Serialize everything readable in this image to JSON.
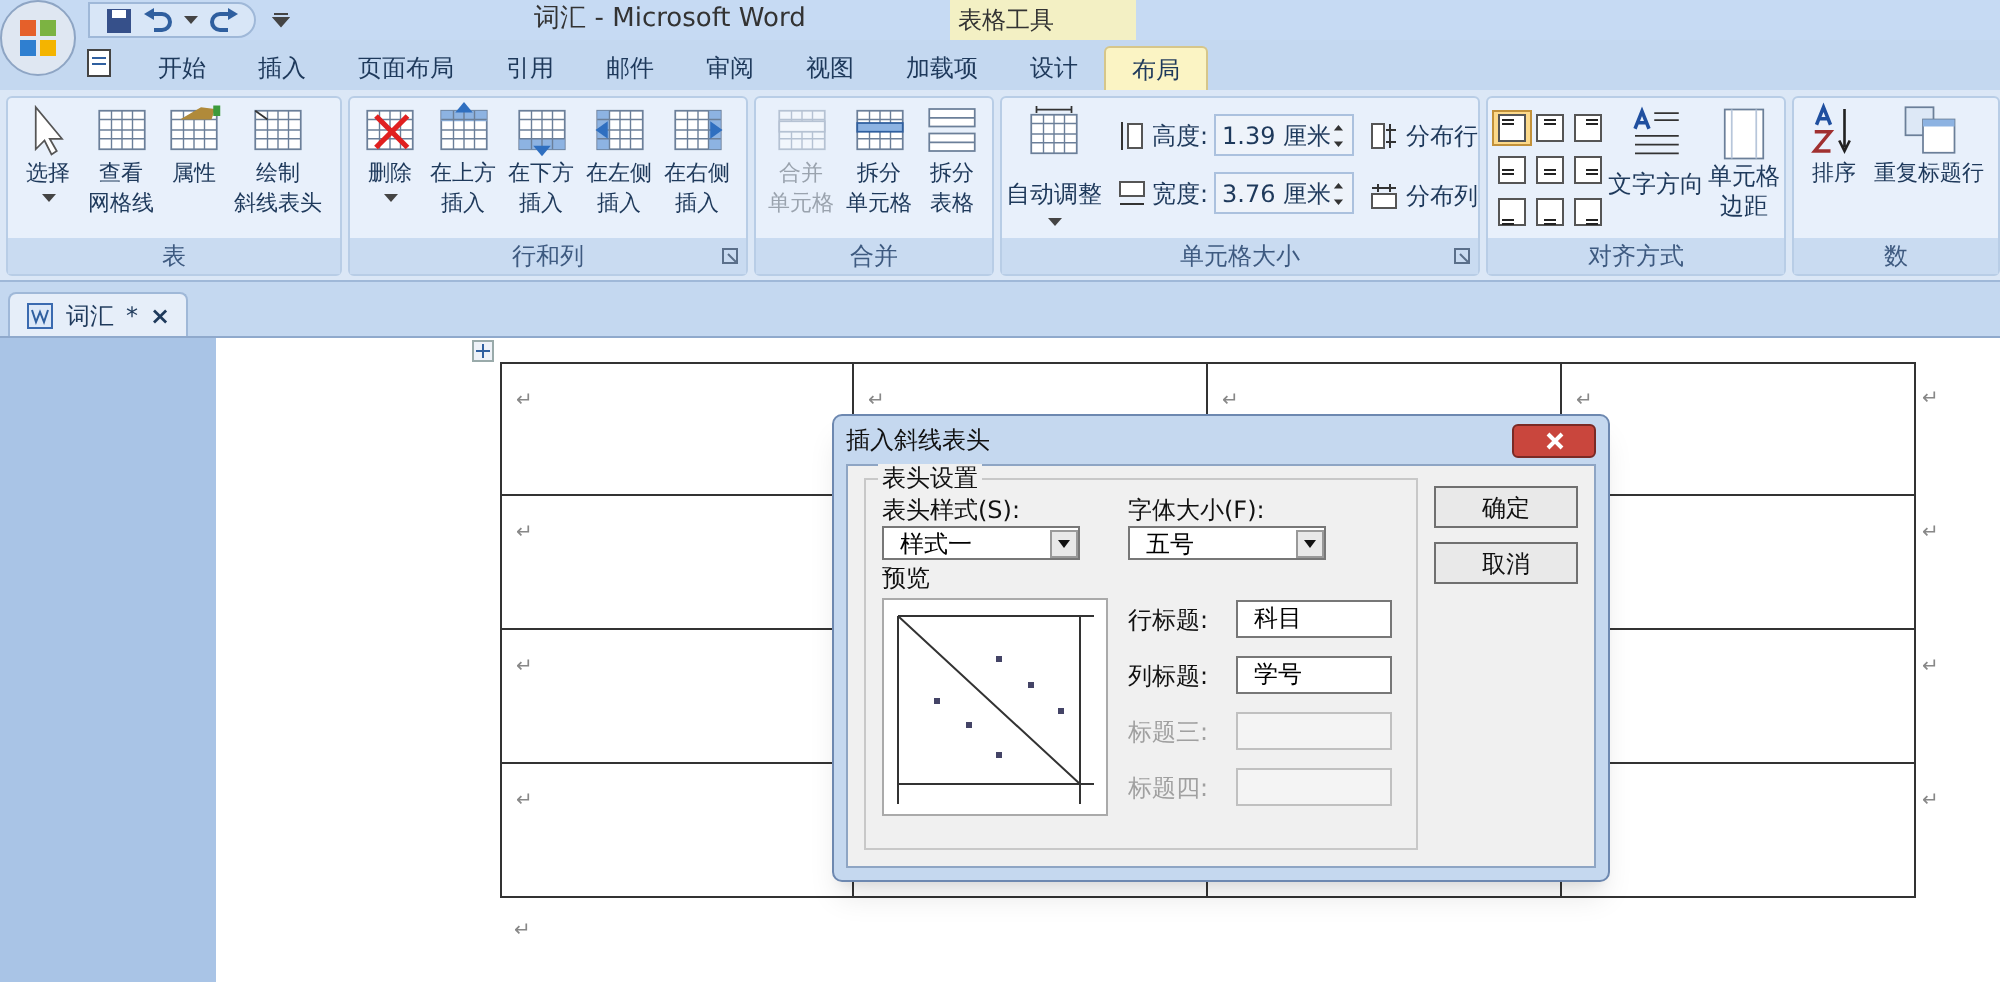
{
  "window": {
    "title": "词汇 - Microsoft Word",
    "context_label": "表格工具"
  },
  "menu_tabs": [
    {
      "label": "开始",
      "selected": false
    },
    {
      "label": "插入",
      "selected": false
    },
    {
      "label": "页面布局",
      "selected": false
    },
    {
      "label": "引用",
      "selected": false
    },
    {
      "label": "邮件",
      "selected": false
    },
    {
      "label": "审阅",
      "selected": false
    },
    {
      "label": "视图",
      "selected": false
    },
    {
      "label": "加载项",
      "selected": false
    },
    {
      "label": "设计",
      "selected": false
    },
    {
      "label": "布局",
      "selected": true
    }
  ],
  "ribbon": {
    "groups": [
      {
        "label": "表",
        "launcher": false,
        "items": [
          {
            "kind": "pointer",
            "lines": [
              "选择"
            ],
            "dropdown": true,
            "disabled": false
          },
          {
            "kind": "grid",
            "lines": [
              "查看",
              "网格线"
            ],
            "dropdown": false,
            "disabled": false
          },
          {
            "kind": "properties",
            "lines": [
              "属性"
            ],
            "dropdown": false,
            "disabled": false
          },
          {
            "kind": "diagonal",
            "lines": [
              "绘制",
              "斜线表头"
            ],
            "dropdown": false,
            "disabled": false
          }
        ]
      },
      {
        "label": "行和列",
        "launcher": true,
        "items": [
          {
            "kind": "delete",
            "lines": [
              "删除"
            ],
            "dropdown": true,
            "disabled": false
          },
          {
            "kind": "above",
            "lines": [
              "在上方",
              "插入"
            ],
            "dropdown": false,
            "disabled": false
          },
          {
            "kind": "below",
            "lines": [
              "在下方",
              "插入"
            ],
            "dropdown": false,
            "disabled": false
          },
          {
            "kind": "left",
            "lines": [
              "在左侧",
              "插入"
            ],
            "dropdown": false,
            "disabled": false
          },
          {
            "kind": "right",
            "lines": [
              "在右侧",
              "插入"
            ],
            "dropdown": false,
            "disabled": false
          }
        ]
      },
      {
        "label": "合并",
        "launcher": false,
        "items": [
          {
            "kind": "merge",
            "lines": [
              "合并",
              "单元格"
            ],
            "dropdown": false,
            "disabled": true
          },
          {
            "kind": "split",
            "lines": [
              "拆分",
              "单元格"
            ],
            "dropdown": false,
            "disabled": false
          },
          {
            "kind": "splittable",
            "lines": [
              "拆分",
              "表格"
            ],
            "dropdown": false,
            "disabled": false
          }
        ]
      },
      {
        "label": "单元格大小",
        "launcher": true,
        "kind": "size"
      },
      {
        "label": "对齐方式",
        "launcher": false,
        "kind": "align"
      },
      {
        "label": "数",
        "launcher": false,
        "items": [
          {
            "kind": "sort",
            "lines": [
              "排序"
            ],
            "dropdown": false,
            "disabled": false
          },
          {
            "kind": "repeat",
            "lines": [
              "重复标题行"
            ],
            "dropdown": false,
            "disabled": false
          }
        ]
      }
    ],
    "cell_size": {
      "autofit": "自动调整",
      "height_label": "高度:",
      "height_value": "1.39 厘米",
      "width_label": "宽度:",
      "width_value": "3.76 厘米",
      "distribute_rows": "分布行",
      "distribute_cols": "分布列"
    },
    "alignment": {
      "buttons": [
        {
          "selected": true
        },
        {
          "selected": false
        },
        {
          "selected": false
        },
        {
          "selected": false
        },
        {
          "selected": false
        },
        {
          "selected": false
        },
        {
          "selected": false
        },
        {
          "selected": false
        },
        {
          "selected": false
        }
      ],
      "text_direction": "文字方向",
      "cell_margins": [
        "单元格",
        "边距"
      ]
    }
  },
  "document_tab": {
    "title": "词汇",
    "modified": "*",
    "close": "×"
  },
  "table": {
    "rows": [
      {
        "marks": [
          "↵",
          "↵",
          "↵",
          "↵"
        ],
        "end": "↵"
      },
      {
        "marks": [
          "↵"
        ],
        "end": "↵"
      },
      {
        "marks": [
          "↵"
        ],
        "end": "↵"
      },
      {
        "marks": [
          "↵"
        ],
        "end": "↵"
      }
    ],
    "after": "↵"
  },
  "dialog": {
    "title": "插入斜线表头",
    "group_title": "表头设置",
    "style_label": "表头样式(S):",
    "style_value": "样式一",
    "font_label": "字体大小(F):",
    "font_value": "五号",
    "preview_label": "预览",
    "fields": [
      {
        "label": "行标题:",
        "value": "科目",
        "disabled": false
      },
      {
        "label": "列标题:",
        "value": "学号",
        "disabled": false
      },
      {
        "label": "标题三:",
        "disabled": true
      },
      {
        "label": "标题四:",
        "disabled": true
      }
    ],
    "ok": "确定",
    "cancel": "取消"
  }
}
